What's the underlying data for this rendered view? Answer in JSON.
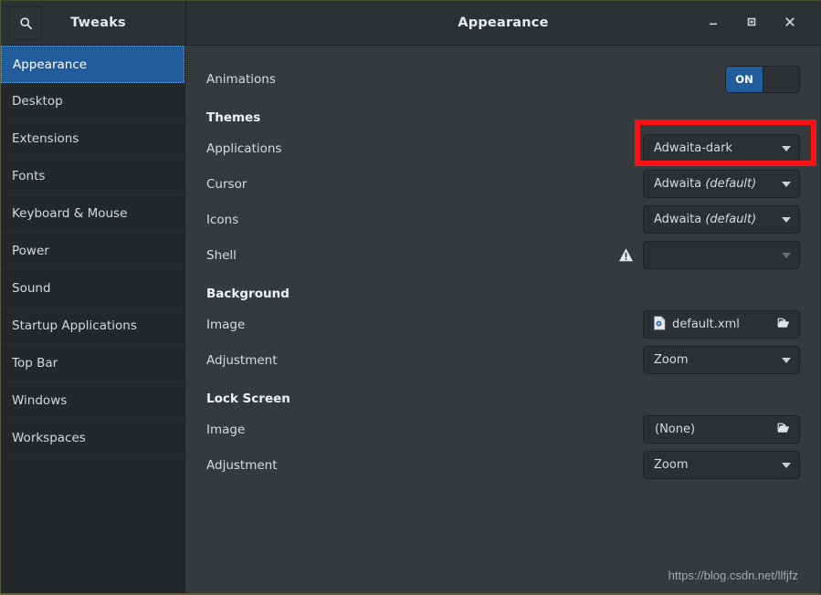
{
  "header": {
    "search_icon": "search-icon",
    "app_title": "Tweaks",
    "window_title": "Appearance",
    "minimize_label": "–",
    "maximize_label": "□",
    "close_label": "×"
  },
  "sidebar": {
    "items": [
      {
        "label": "Appearance",
        "selected": true
      },
      {
        "label": "Desktop",
        "selected": false
      },
      {
        "label": "Extensions",
        "selected": false
      },
      {
        "label": "Fonts",
        "selected": false
      },
      {
        "label": "Keyboard & Mouse",
        "selected": false
      },
      {
        "label": "Power",
        "selected": false
      },
      {
        "label": "Sound",
        "selected": false
      },
      {
        "label": "Startup Applications",
        "selected": false
      },
      {
        "label": "Top Bar",
        "selected": false
      },
      {
        "label": "Windows",
        "selected": false
      },
      {
        "label": "Workspaces",
        "selected": false
      }
    ]
  },
  "main": {
    "animations": {
      "label": "Animations",
      "toggle_state": "ON"
    },
    "themes": {
      "title": "Themes",
      "applications": {
        "label": "Applications",
        "value": "Adwaita-dark",
        "value_italic": ""
      },
      "cursor": {
        "label": "Cursor",
        "value": "Adwaita ",
        "value_italic": "(default)"
      },
      "icons": {
        "label": "Icons",
        "value": "Adwaita ",
        "value_italic": "(default)"
      },
      "shell": {
        "label": "Shell",
        "value": "",
        "value_italic": "",
        "warning_icon": "warning-icon",
        "disabled": true
      }
    },
    "background": {
      "title": "Background",
      "image": {
        "label": "Image",
        "value": "default.xml",
        "file_icon": "xml-file-icon",
        "open_icon": "folder-open-icon"
      },
      "adjustment": {
        "label": "Adjustment",
        "value": "Zoom"
      }
    },
    "lock_screen": {
      "title": "Lock Screen",
      "image": {
        "label": "Image",
        "value": "(None)",
        "open_icon": "folder-open-icon"
      },
      "adjustment": {
        "label": "Adjustment",
        "value": "Zoom"
      }
    }
  },
  "annotation": {
    "highlight_color": "#fb1313",
    "target": "applications-theme-combobox"
  },
  "watermark": {
    "text": "https://blog.csdn.net/llfjfz"
  },
  "colors": {
    "window_bg": "#353a3d",
    "sidebar_bg": "#24282b",
    "headerbar_bg": "#2c3134",
    "selection_blue": "#215d9c",
    "control_bg": "#2b3034",
    "text": "#d9dcdd"
  }
}
